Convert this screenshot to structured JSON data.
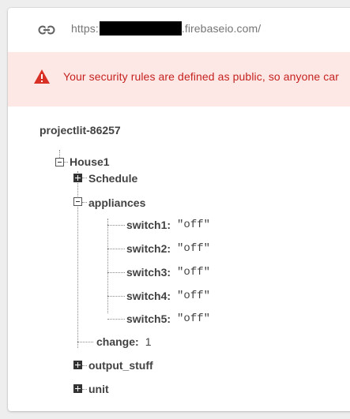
{
  "url": {
    "prefix": "https:",
    "suffix": ".firebaseio.com/",
    "icon": "link-icon"
  },
  "warning": {
    "icon": "warning-triangle-icon",
    "text": "Your security rules are defined as public, so anyone car",
    "color": "#c5221f",
    "background": "#fde8e6"
  },
  "tree": {
    "root": "projectlit-86257",
    "house": {
      "label": "House1",
      "schedule": "Schedule",
      "appliances": {
        "label": "appliances",
        "switches": [
          {
            "key": "switch1:",
            "value": "\"off\""
          },
          {
            "key": "switch2:",
            "value": "\"off\""
          },
          {
            "key": "switch3:",
            "value": "\"off\""
          },
          {
            "key": "switch4:",
            "value": "\"off\""
          },
          {
            "key": "switch5:",
            "value": "\"off\""
          }
        ]
      },
      "change": {
        "key": "change:",
        "value": "1"
      },
      "output_stuff": "output_stuff",
      "unit": "unit"
    }
  }
}
